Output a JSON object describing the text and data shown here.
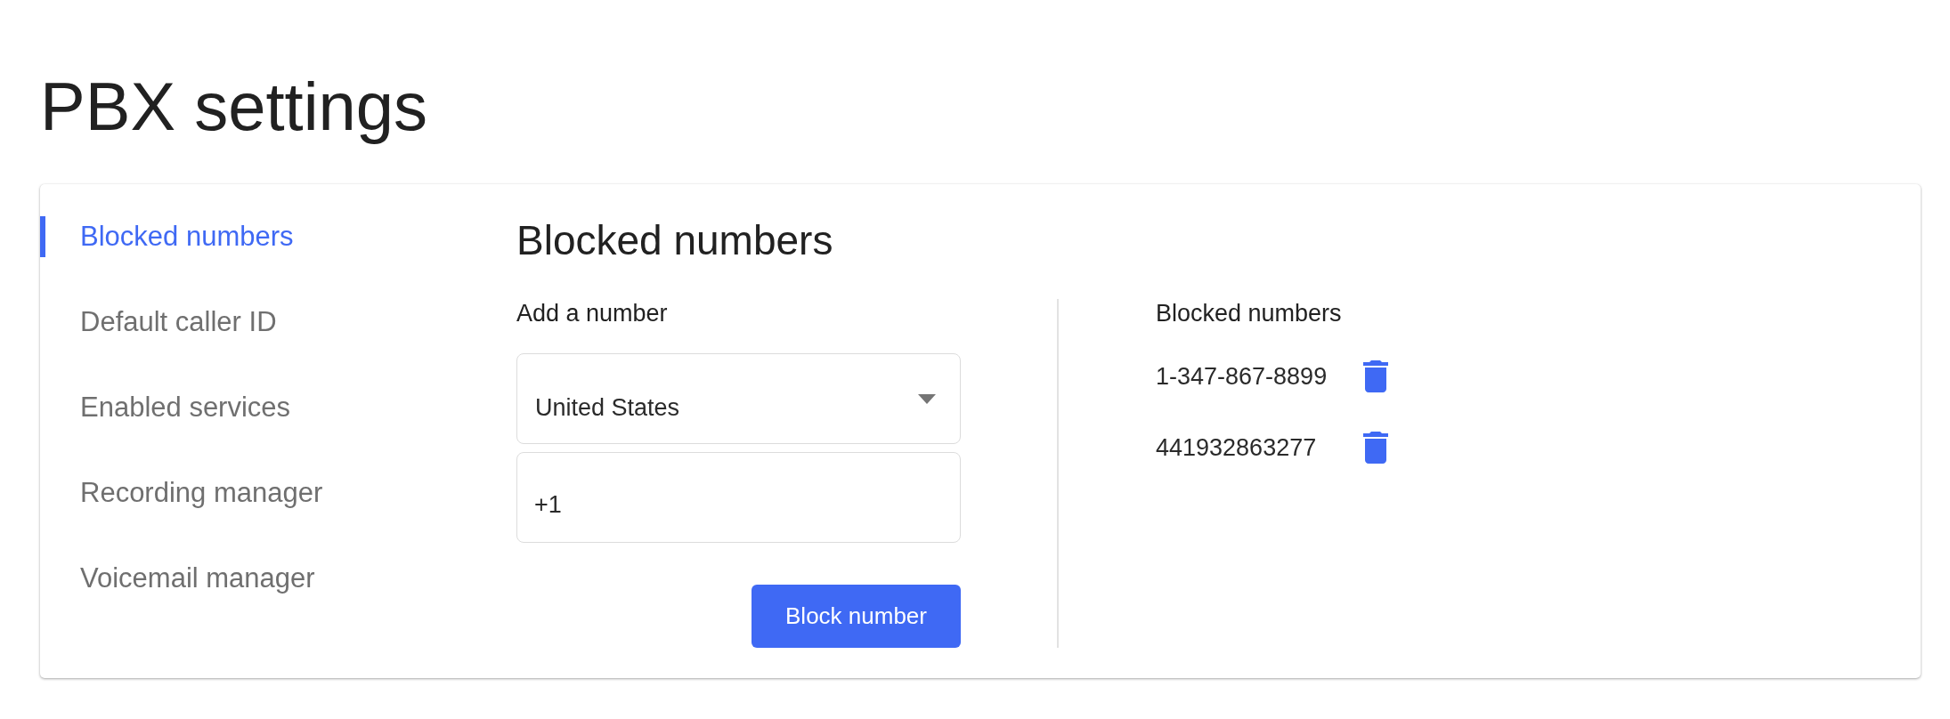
{
  "page": {
    "title": "PBX settings"
  },
  "sidebar": {
    "items": [
      {
        "label": "Blocked numbers",
        "selected": true
      },
      {
        "label": "Default caller ID",
        "selected": false
      },
      {
        "label": "Enabled services",
        "selected": false
      },
      {
        "label": "Recording manager",
        "selected": false
      },
      {
        "label": "Voicemail manager",
        "selected": false
      }
    ]
  },
  "content": {
    "heading": "Blocked numbers",
    "add_form": {
      "label": "Add a number",
      "country_select": {
        "value": "United States"
      },
      "phone_field": {
        "value": "+1"
      },
      "submit_button": "Block number"
    },
    "blocked_list": {
      "label": "Blocked numbers",
      "numbers": [
        {
          "number": "1-347-867-8899"
        },
        {
          "number": "441932863277"
        }
      ]
    }
  }
}
